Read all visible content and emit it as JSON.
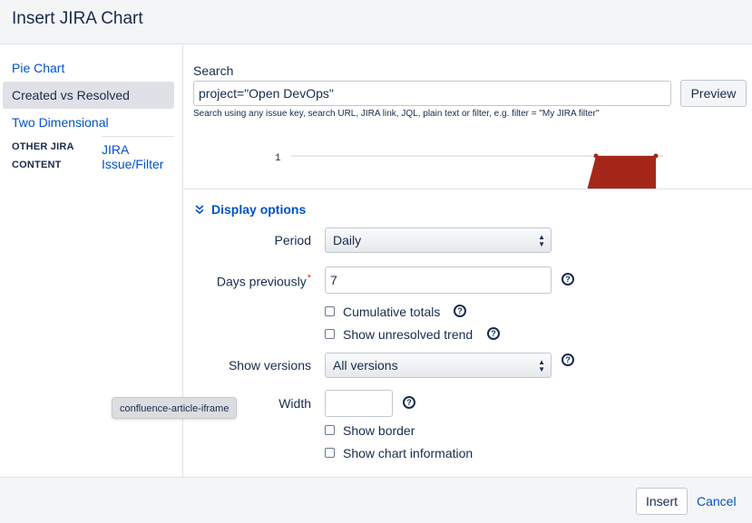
{
  "dialog": {
    "title": "Insert JIRA Chart"
  },
  "sidebar": {
    "items": [
      {
        "label": "Pie Chart"
      },
      {
        "label": "Created vs Resolved",
        "selected": true
      },
      {
        "label": "Two Dimensional"
      }
    ],
    "other_label": "OTHER JIRA CONTENT",
    "other_link": "JIRA Issue/Filter"
  },
  "search": {
    "label": "Search",
    "value": "project=\"Open DevOps\"",
    "preview_label": "Preview",
    "help_text": "Search using any issue key, search URL, JIRA link, JQL, plain text or filter, e.g. filter = \"My JIRA filter\""
  },
  "preview_chart": {
    "y_tick_label": "1",
    "bar_color": "#a5271a"
  },
  "options": {
    "toggle_label": "Display options",
    "toggle_icon": "double-chevron-down-icon",
    "period": {
      "label": "Period",
      "value": "Daily"
    },
    "days_previously": {
      "label": "Days previously",
      "required_mark": "*",
      "value": "7"
    },
    "cumulative_totals": {
      "label": "Cumulative totals",
      "checked": false
    },
    "show_unresolved_trend": {
      "label": "Show unresolved trend",
      "checked": false
    },
    "show_versions": {
      "label": "Show versions",
      "value": "All versions"
    },
    "width": {
      "label": "Width",
      "value": ""
    },
    "show_border": {
      "label": "Show border",
      "checked": false
    },
    "show_chart_information": {
      "label": "Show chart information",
      "checked": false
    },
    "help_glyph": "?"
  },
  "tooltip": {
    "text": "confluence-article-iframe"
  },
  "footer": {
    "insert_label": "Insert",
    "cancel_label": "Cancel"
  },
  "colors": {
    "link": "#0052cc",
    "text": "#172b4d",
    "required": "#de350b"
  }
}
